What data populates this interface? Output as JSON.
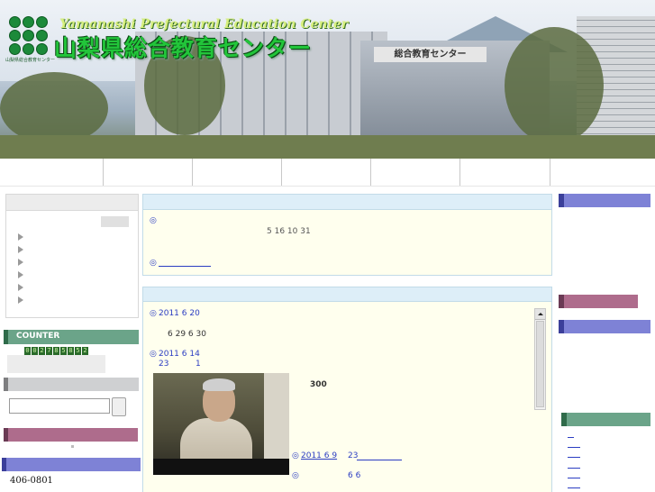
{
  "header": {
    "title_en": "Yamanashi Prefectural Education Center",
    "title_ja": "山梨県総合教育センター",
    "logo_caption": "山梨県総合教育センター",
    "building_sign": "総合教育センター",
    "logo_icon": "green-dots-logo-icon"
  },
  "nav": {
    "item_count": 7
  },
  "left": {
    "counter_label": "COUNTER",
    "counter_digits": [
      "0",
      "0",
      "2",
      "7",
      "8",
      "5",
      "8",
      "5",
      "2"
    ],
    "search_placeholder": "",
    "postal_code": "406-0801"
  },
  "center": {
    "notice": {
      "bullet": "◎",
      "line1": "5  16    10  31",
      "link_bullet": "◎"
    },
    "news": {
      "item1_bullet": "◎",
      "item1_date": "2011  6  20",
      "item1_text": "6  29   6  30",
      "item2_bullet": "◎",
      "item2_date": "2011  6  14",
      "item2_text_a": "23",
      "item2_text_b": "1",
      "item2_count": "300",
      "item3_bullet": "◎",
      "item3_date": "2011  6  9",
      "item3_text": "23",
      "item4_bullet": "◎",
      "item4_text": "6  6"
    }
  },
  "colors": {
    "blue_accent": "#7e82d6",
    "pink_accent": "#ae6c8c",
    "green_accent": "#6ba489",
    "center_bg": "#ffffee",
    "center_head": "#ddeef8"
  }
}
